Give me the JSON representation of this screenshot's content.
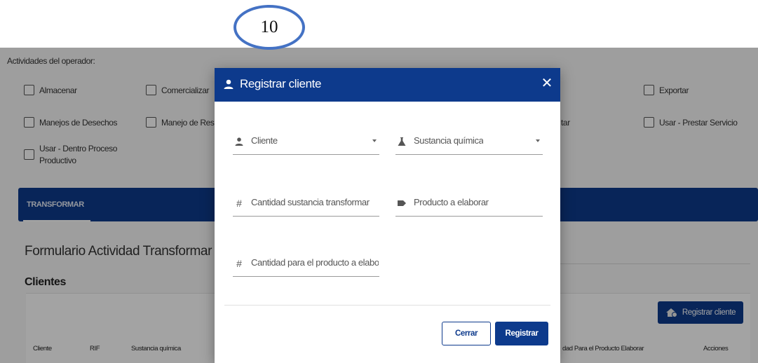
{
  "badge": {
    "number": "10"
  },
  "activities": {
    "title": "Actividades del operador:",
    "items": [
      {
        "label": "Almacenar"
      },
      {
        "label": "Comercializar"
      },
      {
        "label": "Exportar"
      },
      {
        "label": "Manejos de Desechos"
      },
      {
        "label": "Manejo de Residu"
      },
      {
        "label": "tar"
      },
      {
        "label": "Usar - Prestar Servicio"
      },
      {
        "label": "Usar - Dentro Proceso Productivo"
      }
    ]
  },
  "tabs": [
    {
      "label": "TRANSFORMAR"
    }
  ],
  "form_title": "Formulario Actividad Transformar",
  "clients": {
    "title": "Clientes",
    "register_button": "Registrar cliente",
    "columns": [
      "Cliente",
      "RIF",
      "Sustancia química",
      "dad Para el Producto Elaborar",
      "Acciones"
    ]
  },
  "modal": {
    "title": "Registrar cliente",
    "close_icon": "close-icon",
    "fields": {
      "cliente": "Cliente",
      "sustancia": "Sustancia química",
      "cantidad_transformar": "Cantidad sustancia transformar",
      "producto": "Producto a elaborar",
      "cantidad_producto": "Cantidad para el producto a elabor..."
    },
    "buttons": {
      "cerrar": "Cerrar",
      "registrar": "Registrar"
    }
  },
  "colors": {
    "primary": "#0d3a8c",
    "badge_border": "#4472c4",
    "overlay": "rgba(0,0,0,0.36)"
  }
}
